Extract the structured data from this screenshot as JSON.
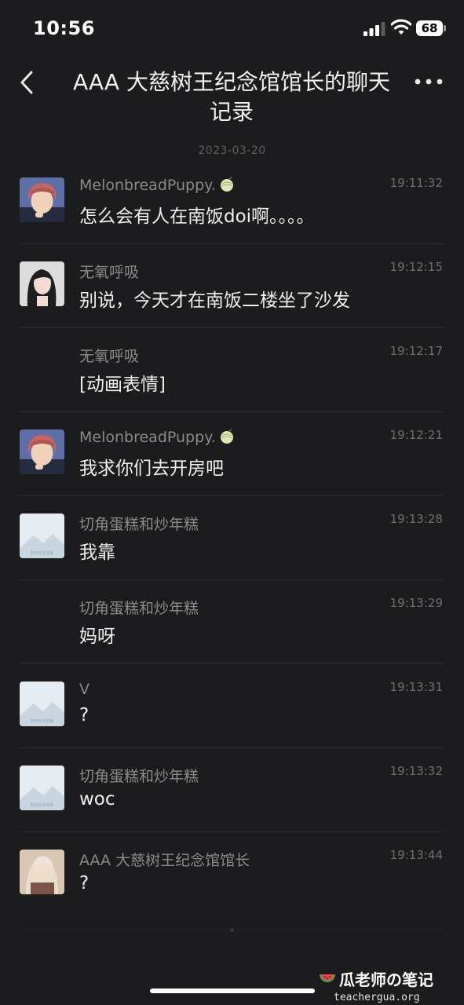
{
  "status_bar": {
    "time": "10:56",
    "battery": "68"
  },
  "header": {
    "title": "AAA 大慈树王纪念馆馆长的聊天记录"
  },
  "date_separator": "2023-03-20",
  "messages": [
    {
      "sender": "MelonbreadPuppy.",
      "time": "19:11:32",
      "text": "怎么会有人在南饭doi啊。。。。"
    },
    {
      "sender": "无氧呼吸",
      "time": "19:12:15",
      "text": "别说，今天才在南饭二楼坐了沙发"
    },
    {
      "sender": "无氧呼吸",
      "time": "19:12:17",
      "text": "[动画表情]"
    },
    {
      "sender": "MelonbreadPuppy.",
      "time": "19:12:21",
      "text": "我求你们去开房吧"
    },
    {
      "sender": "切角蛋糕和炒年糕",
      "time": "19:13:28",
      "text": "我靠"
    },
    {
      "sender": "切角蛋糕和炒年糕",
      "time": "19:13:29",
      "text": "妈呀"
    },
    {
      "sender": "V",
      "time": "19:13:31",
      "text": "?"
    },
    {
      "sender": "切角蛋糕和炒年糕",
      "time": "19:13:32",
      "text": "woc"
    },
    {
      "sender": "AAA 大慈树王纪念馆馆长",
      "time": "19:13:44",
      "text": "?"
    }
  ],
  "placeholder_avatar_caption": "暂时无法查看",
  "watermark": {
    "title": "瓜老师の笔记",
    "url": "teachergua.org"
  },
  "colors": {
    "background": "#1c1c1e",
    "text_primary": "#eeeeee",
    "text_secondary": "#8a8a8a"
  }
}
